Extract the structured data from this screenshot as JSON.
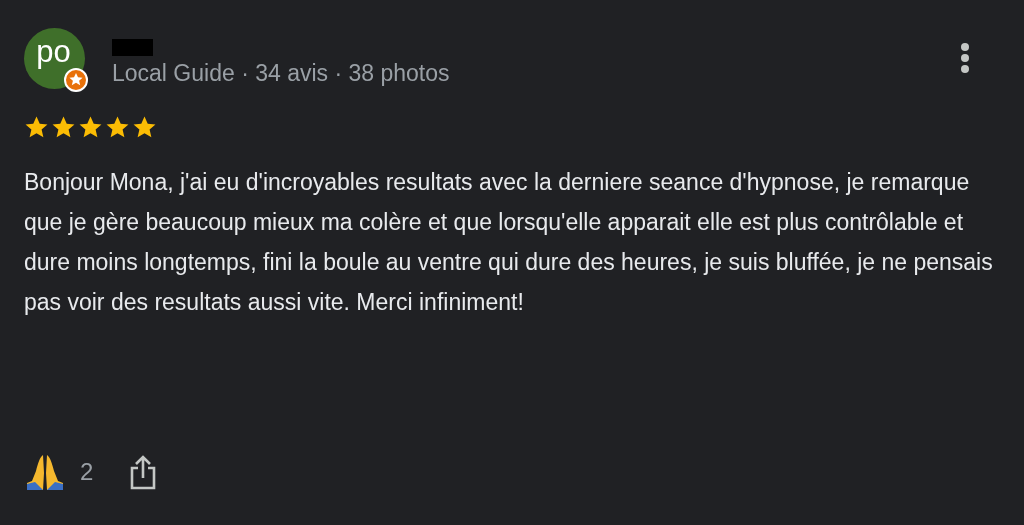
{
  "reviewer": {
    "avatar_initials": "po",
    "meta": "Local Guide · 34 avis · 38 photos"
  },
  "rating": {
    "stars": 5
  },
  "review_text": "Bonjour Mona, j'ai eu d'incroyables resultats avec la derniere seance d'hypnose, je remarque que je gère beaucoup mieux ma colère et que lorsqu'elle apparait elle est plus contrôlable et dure moins longtemps, fini la boule au ventre qui dure des heures, je suis bluffée, je ne pensais pas voir des resultats aussi vite. Merci infiniment!",
  "reactions": {
    "count": "2"
  }
}
